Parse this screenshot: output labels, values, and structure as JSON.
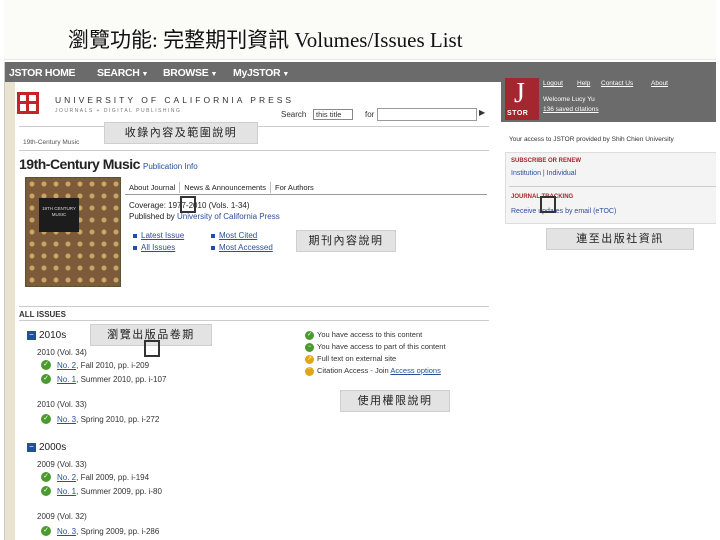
{
  "slide": {
    "title": "瀏覽功能: 完整期刊資訊 Volumes/Issues List"
  },
  "nav": {
    "items": [
      "JSTOR HOME",
      "SEARCH",
      "BROWSE",
      "MyJSTOR"
    ]
  },
  "publisher": {
    "name": "UNIVERSITY OF CALIFORNIA PRESS",
    "subtitle": "JOURNALS + DIGITAL PUBLISHING"
  },
  "search": {
    "label": "Search",
    "scope": "this title",
    "for_label": "for",
    "go": "▶"
  },
  "breadcrumb": "19th-Century Music",
  "journal": {
    "title": "19th-Century Music",
    "pub_info": "Publication Info",
    "tabs": [
      "About Journal",
      "News & Announcements",
      "For Authors"
    ],
    "coverage": "Coverage: 1977-2010 (Vols. 1-34)",
    "published_prefix": "Published by ",
    "publisher_link": "University of California Press",
    "cover_text": "19TH CENTURY MUSIC",
    "links": {
      "latest": "Latest Issue",
      "all": "All Issues",
      "cited": "Most Cited",
      "accessed": "Most Accessed"
    }
  },
  "all_issues": {
    "heading": "ALL ISSUES",
    "decades": [
      {
        "label": "2010s",
        "years": [
          {
            "label": "2010 (Vol. 34)",
            "issues": [
              {
                "no": "No. 2",
                "rest": ", Fall 2010, pp. i-209"
              },
              {
                "no": "No. 1",
                "rest": ", Summer 2010, pp. i-107"
              }
            ]
          },
          {
            "label": "2010 (Vol. 33)",
            "issues": [
              {
                "no": "No. 3",
                "rest": ", Spring 2010, pp. i-272"
              }
            ]
          }
        ]
      },
      {
        "label": "2000s",
        "years": [
          {
            "label": "2009 (Vol. 33)",
            "issues": [
              {
                "no": "No. 2",
                "rest": ", Fall 2009, pp. i-194"
              },
              {
                "no": "No. 1",
                "rest": ", Summer 2009, pp. i-80"
              }
            ]
          },
          {
            "label": "2009 (Vol. 32)",
            "issues": [
              {
                "no": "No. 3",
                "rest": ", Spring 2009, pp. i-286"
              }
            ]
          }
        ]
      }
    ]
  },
  "legend": {
    "full": "You have access to this content",
    "partial": "You have access to part of this content",
    "external": "Full text on external site",
    "citation": "Citation Access",
    "citation_rest": " - Join",
    "citation_link": "Access options"
  },
  "sidebar": {
    "jstor_letter": "J",
    "jstor_text": "STOR",
    "account_links": [
      "Logout",
      "Help",
      "Contact Us",
      "About"
    ],
    "welcome": "Welcome Lucy Yu",
    "saved": "136 saved citations",
    "access_text": "Your access to JSTOR provided by Shih Chien University",
    "subscribe_head": "SUBSCRIBE OR RENEW",
    "subscribe_link": "Institution | Individual",
    "tracking_head": "JOURNAL TRACKING",
    "tracking_link": "Receive updates by email (eTOC)"
  },
  "annotations": {
    "scope": "收錄內容及範圍說明",
    "content": "期刊內容說明",
    "publisher": "連至出版社資訊",
    "browse": "瀏覽出版品卷期",
    "rights": "使用權限說明"
  },
  "colors": {
    "jstor_red": "#a4262e",
    "link_blue": "#2b4e9a",
    "check_green": "#4a9a2e",
    "nav_gray": "#6b6b6b"
  }
}
